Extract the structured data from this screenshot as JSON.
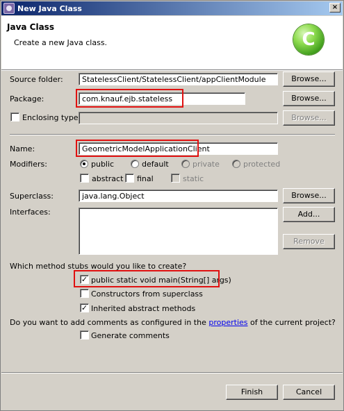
{
  "window": {
    "title": "New Java Class",
    "close_glyph": "×"
  },
  "header": {
    "title": "Java Class",
    "description": "Create a new Java class.",
    "logo_letter": "C"
  },
  "source_folder": {
    "label": "Source folder:",
    "value": "StatelessClient/StatelessClient/appClientModule",
    "browse": "Browse..."
  },
  "package": {
    "label": "Package:",
    "value": "com.knauf.ejb.stateless",
    "browse": "Browse..."
  },
  "enclosing_type": {
    "label": "Enclosing type:",
    "value": "",
    "browse": "Browse..."
  },
  "name": {
    "label": "Name:",
    "value": "GeometricModelApplicationClient"
  },
  "modifiers": {
    "label": "Modifiers:",
    "options": [
      "public",
      "default",
      "private",
      "protected"
    ],
    "selected": "public",
    "flags": [
      "abstract",
      "final",
      "static"
    ]
  },
  "superclass": {
    "label": "Superclass:",
    "value": "java.lang.Object",
    "browse": "Browse..."
  },
  "interfaces": {
    "label": "Interfaces:",
    "add": "Add...",
    "remove": "Remove"
  },
  "stubs": {
    "question": "Which method stubs would you like to create?",
    "options": [
      {
        "label": "public static void main(String[] args)",
        "checked": true
      },
      {
        "label": "Constructors from superclass",
        "checked": false
      },
      {
        "label": "Inherited abstract methods",
        "checked": true
      }
    ]
  },
  "comments": {
    "prefix": "Do you want to add comments as configured in the ",
    "link": "properties",
    "suffix": " of the current project?",
    "option": "Generate comments",
    "checked": false
  },
  "footer": {
    "finish": "Finish",
    "cancel": "Cancel"
  },
  "colors": {
    "highlight": "#e01010",
    "title_start": "#0a246a",
    "title_end": "#a6caf0"
  }
}
